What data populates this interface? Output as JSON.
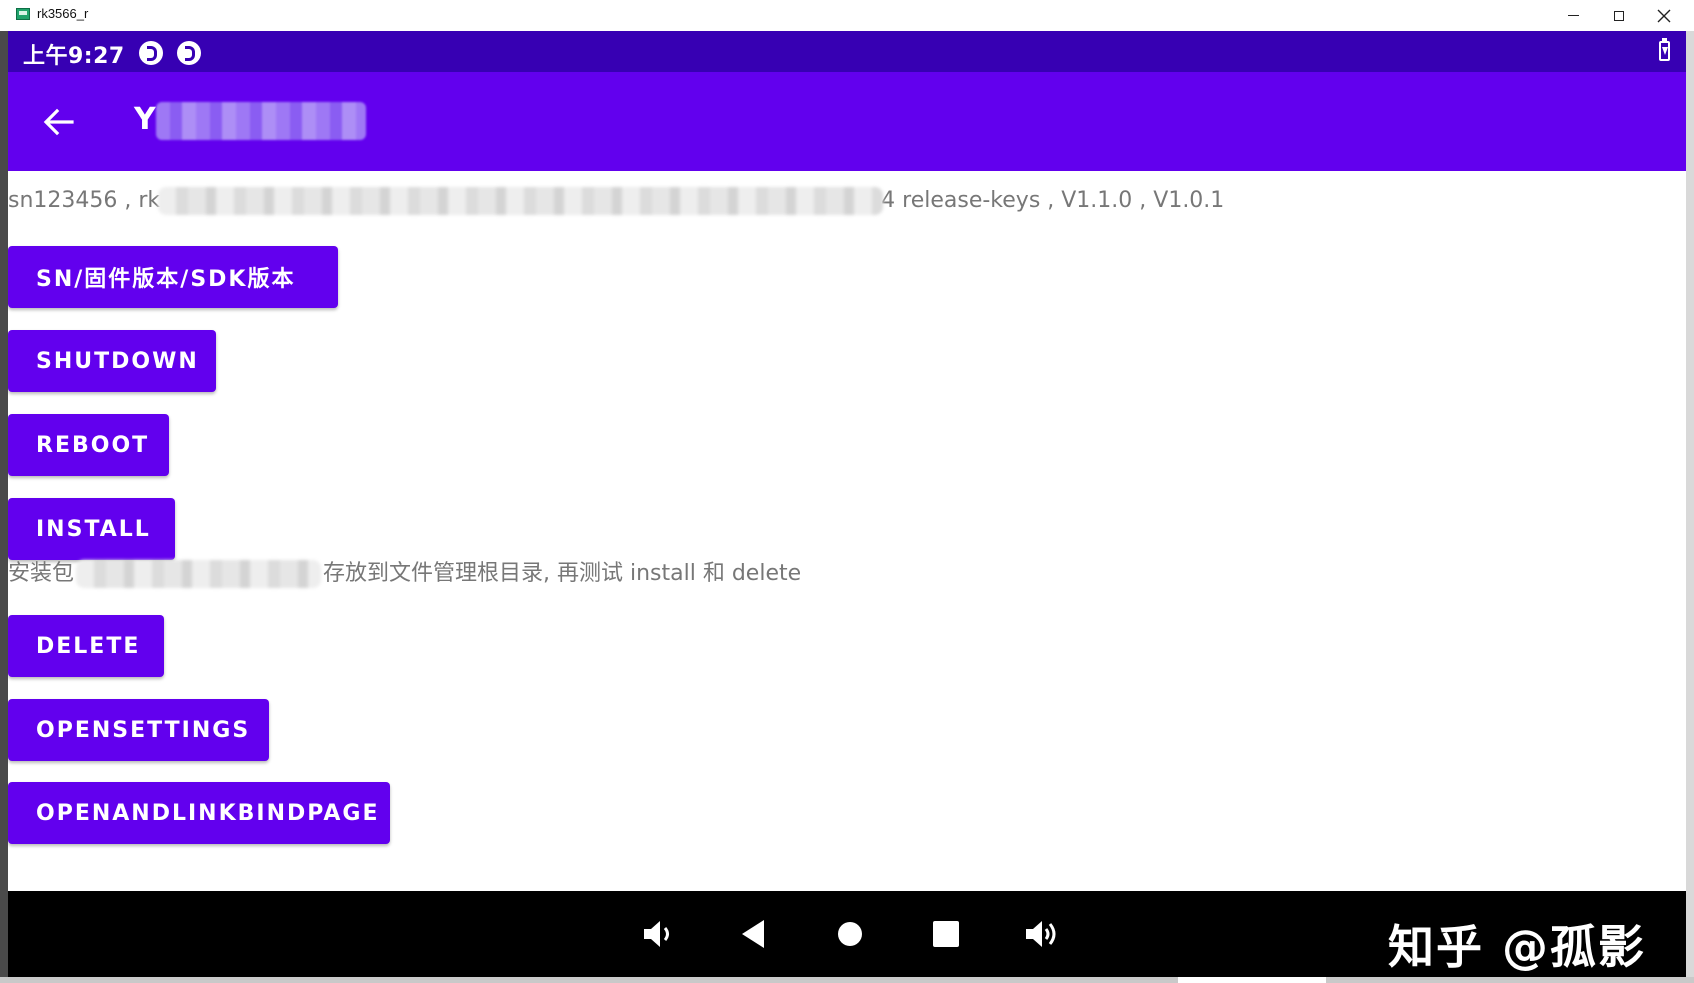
{
  "window": {
    "title": "rk3566_r"
  },
  "status_bar": {
    "time": "上午9:27"
  },
  "app_bar": {
    "title_visible": "Y"
  },
  "info": {
    "prefix": "sn123456 , rk",
    "suffix": "4 release-keys , V1.1.0 , V1.0.1"
  },
  "buttons": {
    "sn": "SN/固件版本/SDK版本",
    "shutdown": "SHUTDOWN",
    "reboot": "REBOOT",
    "install": "INSTALL",
    "delete": "DELETE",
    "opensettings": "OPENSETTINGS",
    "openandlinkbindpage": "OPENANDLINKBINDPAGE"
  },
  "install_note": {
    "prefix": "安装包",
    "suffix": "存放到文件管理根目录, 再测试 install 和 delete"
  },
  "watermark": "知乎 @孤影",
  "colors": {
    "primary": "#6200ee",
    "primary_dark": "#3700b3",
    "nav_bar": "#000000"
  },
  "icons": {
    "back": "arrow-left-icon",
    "vol_down": "volume-down-icon",
    "nav_back": "triangle-back-icon",
    "nav_home": "circle-home-icon",
    "nav_recent": "square-recent-icon",
    "vol_up": "volume-up-icon"
  }
}
